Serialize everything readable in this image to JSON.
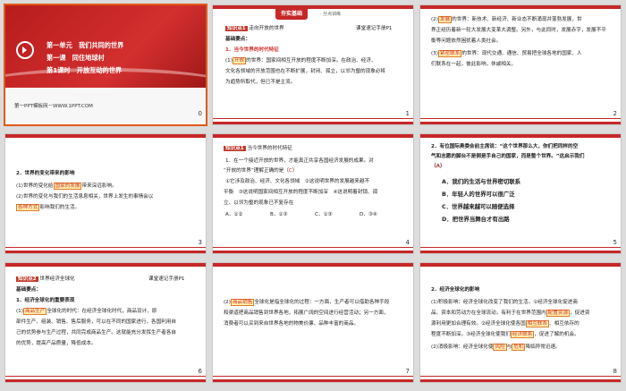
{
  "slides": [
    {
      "number": "0",
      "unit_line": "第一单元　我们共同的世界",
      "lesson_line": "第一课　同住地球村",
      "period_line": "第1课时　开放互动的世界",
      "site": "第一PPT模板网－WWW.1PPT.COM"
    },
    {
      "number": "1",
      "banner": "夯实基础",
      "banner_sub": "· 分点训练",
      "tag": "知识点1",
      "heading": "走向开放的世界",
      "ref": "课堂速记手册P1",
      "subhead": "基础要点：",
      "point1": "1．当今世界的时代特征",
      "l1_pre": "(1)",
      "l1_fill": "开放",
      "l1_post": "的世界：国家间相互开放的程度不断加深。在政治、经济、",
      "l2": "文化各领域的开放范围也在不断扩展，封闭、孤立，以邻为壑的现象必将",
      "l3": "为趋势所取代，但已不是主流。"
    },
    {
      "number": "2",
      "l1_pre": "(2)",
      "l1_fill": "发展",
      "l1_post": "的世界：新技术、新经济、新业态不断涌现并蓬勃发展，世",
      "l2": "界正经历着新一轮大发展大变革大调整。另外，与此同时，发展赤字，发展不平",
      "l3": "衡等问题依然困扰着人类社会。",
      "l4_pre": "(3)",
      "l4_fill": "紧密联系",
      "l4_post": "的世界：现代交通、通信、贸易把全球各地的国家、人",
      "l5": "们联系在一起，彼此影响，休戚相关。"
    },
    {
      "number": "3",
      "point": "2．世界的变化带来的影响",
      "l1_pre": "(1)世界的变化给",
      "l1_fill": "国家的发展",
      "l1_post": "带来深远影响。",
      "l2": "(2)世界的变化与我们的生活息息相关，世界上发生的事情会以",
      "l3_fill": "各种方式",
      "l3_post": "影响我们的生活。"
    },
    {
      "number": "4",
      "tag": "知识点1",
      "heading": "当今世界的时代特征",
      "q1": "1．在一个接近开放的世界，才能真正共享各国经济发展的成果。对",
      "q2": "“开放的世界”理解正确的是（",
      "answer": "C",
      "q2_end": "）",
      "o1": "①它涉及政治、经济、文化各领域　②这说明世界的发展越来越不",
      "o2": "平衡　③这说明国家间相互开放的程度不断加深　④这说明着封锁、孤",
      "o3": "立、以邻为壑的现象已不复存在",
      "A": "A．①②",
      "B": "B．①③",
      "C": "C．①③",
      "D": "D．③④"
    },
    {
      "number": "5",
      "q1": "2．有位国际奥委会前主席说：“这个世界那么大，你们把同样的空",
      "q2": "气和志愿的脚台不是倒是手自己的国家，而是整个世界。”这启示我们",
      "q3_open": "（",
      "answer": "A",
      "q3_close": "）",
      "A": "A．我们的生活与世界密切联系",
      "B": "B．年轻人的世界可以很广泛",
      "C": "C．世界越来越可以随便选择",
      "D": "D．把世界当舞台才有出路"
    },
    {
      "number": "6",
      "tag": "知识点2",
      "heading": "世界经济全球化",
      "ref": "课堂速记手册P1",
      "subhead": "基础要点：",
      "point": "1．经济全球化的重要表现",
      "l1_pre": "(1)",
      "l1_fill": "商品生产",
      "l1_post": "全球化的时代：在经济全球化时代，商品设计、原",
      "l2": "部件生产、组装、销售、售后服务，可以在不同的国家进行，各国利用自",
      "l3": "己的优势参与生产过程，共同完成商品生产。这就能充分发挥生产者各自",
      "l4": "的优势，提高产品质量，降低成本。"
    },
    {
      "number": "7",
      "l1_pre": "(2)",
      "l1_fill": "商品销售",
      "l1_post": "全球化是指全球化的过程：一方面，生产者可以借助各种手段",
      "l2": "和渠道把商品销售到世界各地，拓展广阔的空间进行经营活动；另一方面，",
      "l3": "消费者可以买到来自世界各地的物美价廉、品种丰富的商品。"
    },
    {
      "number": "8",
      "point": "2．经济全球化的影响",
      "l1": "(1)积极影响：经济全球化改变了我们的生活。①经济全球化促进商",
      "l2_pre": "品、资本和劳动力在全球流动，有利于在世界范围内",
      "l2_fill": "配置资源",
      "l2_post": "，促进资",
      "l3_pre": "源利用更加合理有效。②经济全球化使各国",
      "l3_fill": "相互联系",
      "l3_post": "、相互依存的",
      "l4_pre": "程度不断加深。③经济全球化使我们",
      "l4_fill": "经济联系",
      "l4_post": "，促进了解的机会。",
      "l5_pre": "(2)消极影响：经济全球化使",
      "l5_fill1": "风险",
      "l5_mid": "与",
      "l5_fill2": "危机",
      "l5_post": "降临异常迅速。"
    }
  ],
  "colors": {
    "accent": "#c62828",
    "highlight": "#fff3b0",
    "selection": "#e05a1a"
  }
}
